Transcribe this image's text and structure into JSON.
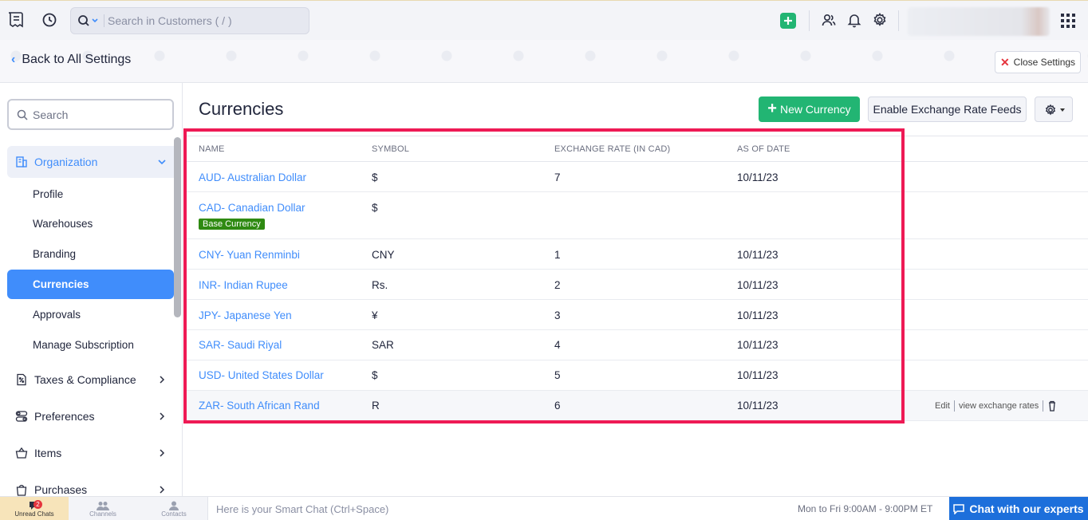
{
  "topbar": {
    "search_placeholder": "Search in Customers ( / )"
  },
  "settings_header": {
    "back_label": "Back to All Settings",
    "close_label": "Close Settings"
  },
  "sidebar": {
    "search_placeholder": "Search",
    "org_group": "Organization",
    "sub_items": [
      "Profile",
      "Warehouses",
      "Branding",
      "Currencies",
      "Approvals",
      "Manage Subscription"
    ],
    "active_item": "Currencies",
    "groups": [
      "Taxes & Compliance",
      "Preferences",
      "Items",
      "Purchases"
    ]
  },
  "main": {
    "title": "Currencies",
    "new_button": "New Currency",
    "feeds_button": "Enable Exchange Rate Feeds"
  },
  "table": {
    "headers": [
      "NAME",
      "SYMBOL",
      "EXCHANGE RATE (IN CAD)",
      "AS OF DATE"
    ],
    "base_badge": "Base Currency",
    "rows": [
      {
        "name": "AUD- Australian Dollar",
        "symbol": "$",
        "rate": "7",
        "date": "10/11/23"
      },
      {
        "name": "CAD- Canadian Dollar",
        "symbol": "$",
        "rate": "",
        "date": ""
      },
      {
        "name": "CNY- Yuan Renminbi",
        "symbol": "CNY",
        "rate": "1",
        "date": "10/11/23"
      },
      {
        "name": "INR- Indian Rupee",
        "symbol": "Rs.",
        "rate": "2",
        "date": "10/11/23"
      },
      {
        "name": "JPY- Japanese Yen",
        "symbol": "¥",
        "rate": "3",
        "date": "10/11/23"
      },
      {
        "name": "SAR- Saudi Riyal",
        "symbol": "SAR",
        "rate": "4",
        "date": "10/11/23"
      },
      {
        "name": "USD- United States Dollar",
        "symbol": "$",
        "rate": "5",
        "date": "10/11/23"
      },
      {
        "name": "ZAR- South African Rand",
        "symbol": "R",
        "rate": "6",
        "date": "10/11/23"
      }
    ],
    "row_actions": {
      "edit": "Edit",
      "view_rates": "view exchange rates"
    }
  },
  "bottombar": {
    "tabs": [
      "Unread Chats",
      "Channels",
      "Contacts"
    ],
    "unread_count": "2",
    "smart_chat_placeholder": "Here is your Smart Chat (Ctrl+Space)",
    "hours": "Mon to Fri 9:00AM - 9:00PM ET",
    "chat_button": "Chat with our experts"
  },
  "colors": {
    "accent_blue": "#408dfb",
    "green": "#22b573",
    "badge_green": "#2f8a12",
    "highlight": "#ee1a55",
    "chat_blue": "#1d6fdb"
  }
}
